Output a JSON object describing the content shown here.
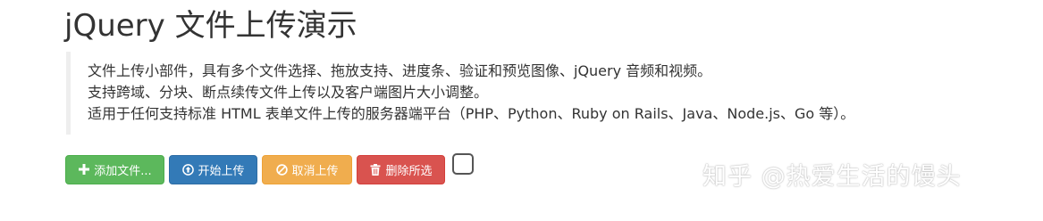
{
  "title": "jQuery 文件上传演示",
  "description": {
    "lines": [
      "文件上传小部件，具有多个文件选择、拖放支持、进度条、验证和预览图像、jQuery 音频和视频。",
      "支持跨域、分块、断点续传文件上传以及客户端图片大小调整。",
      "适用于任何支持标准 HTML 表单文件上传的服务器端平台（PHP、Python、Ruby on Rails、Java、Node.js、Go 等）。"
    ]
  },
  "toolbar": {
    "add_label": "添加文件...",
    "start_label": "开始上传",
    "cancel_label": "取消上传",
    "delete_label": "删除所选",
    "select_all_checked": false
  },
  "watermark": "知乎 @热爱生活的馒头",
  "colors": {
    "success": "#5cb85c",
    "primary": "#337ab7",
    "warning": "#f0ad4e",
    "danger": "#d9534f"
  },
  "icons": {
    "add": "plus-icon",
    "start": "upload-circle-icon",
    "cancel": "ban-circle-icon",
    "delete": "trash-icon"
  }
}
